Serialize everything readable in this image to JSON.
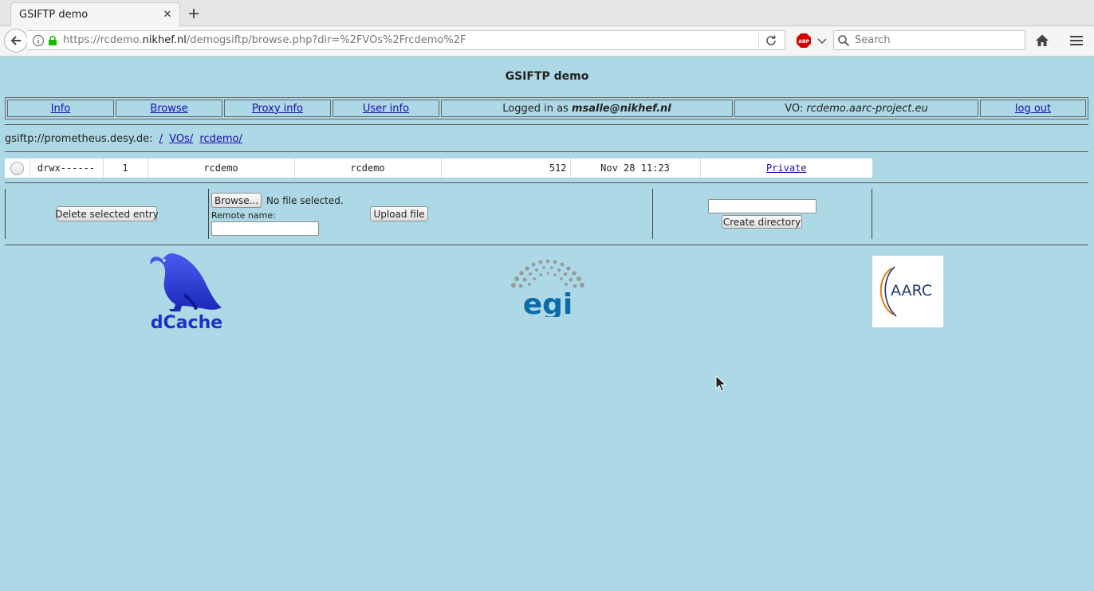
{
  "browser": {
    "tab_title": "GSIFTP demo",
    "url_prefix": "https://rcdemo.",
    "url_host": "nikhef.nl",
    "url_path": "/demogsiftp/browse.php?dir=%2FVOs%2Frcdemo%2F",
    "search_placeholder": "Search",
    "abp_label": "ABP"
  },
  "page": {
    "title": "GSIFTP demo",
    "nav": {
      "info": "Info",
      "browse": "Browse",
      "proxy_info": "Proxy info",
      "user_info": "User info",
      "logged_in_prefix": "Logged in as ",
      "logged_in_user": "msalle@nikhef.nl",
      "vo_prefix": "VO: ",
      "vo_name": "rcdemo.aarc-project.eu",
      "logout": "log out"
    },
    "path": {
      "server": "gsiftp://prometheus.desy.de:",
      "crumbs": [
        "/",
        "VOs/",
        "rcdemo/"
      ]
    },
    "files": [
      {
        "permissions": "drwx------",
        "links": "1",
        "owner": "rcdemo",
        "group": "rcdemo",
        "size": "512",
        "date": "Nov 28 11:23",
        "name": "Private"
      }
    ],
    "actions": {
      "delete_label": "Delete selected entry",
      "browse_label": "Browse...",
      "no_file": "No file selected.",
      "remote_name_label": "Remote name:",
      "upload_label": "Upload file",
      "create_dir_label": "Create directory",
      "remote_name_value": "",
      "new_dir_value": ""
    },
    "logos": {
      "dcache": "dCache",
      "egi": "egi",
      "aarc": "AARC"
    }
  },
  "colors": {
    "page_bg": "#add8e6",
    "link": "#1a0dab",
    "dcache_blue": "#1f2fc8",
    "egi_blue": "#0a6ba8"
  }
}
